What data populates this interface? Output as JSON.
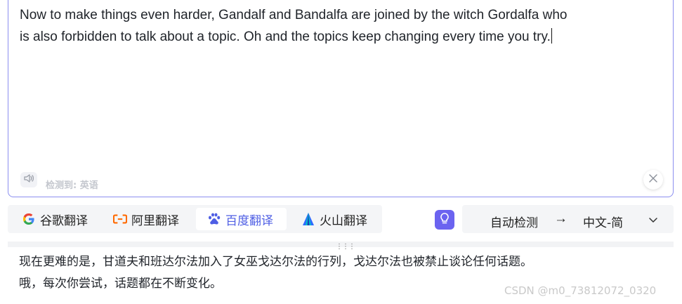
{
  "source": {
    "line1": "Now to make things even harder, Gandalf and Bandalfa are joined by the witch Gordalfa who",
    "line2": "is also forbidden to talk about a topic. Oh and the topics keep changing every time you try.",
    "detected_label": "检测到: 英语",
    "speaker_icon": "speaker-icon",
    "clear_icon": "close-icon"
  },
  "engines": [
    {
      "label": "谷歌翻译",
      "icon": "google-icon",
      "color": "#4285f4"
    },
    {
      "label": "阿里翻译",
      "icon": "alibaba-icon",
      "color": "#ff6a00"
    },
    {
      "label": "百度翻译",
      "icon": "baidu-icon",
      "color": "#4e5ee4",
      "active": true
    },
    {
      "label": "火山翻译",
      "icon": "volcano-icon",
      "color": "#3366ff"
    }
  ],
  "language": {
    "source": "自动检测",
    "arrow": "→",
    "target": "中文-简"
  },
  "result": {
    "line1": "现在更难的是，甘道夫和班达尔法加入了女巫戈达尔法的行列，戈达尔法也被禁止谈论任何话题。",
    "line2": "哦，每次你尝试，话题都在不断变化。"
  },
  "watermark": "CSDN @m0_73812072_0320",
  "colors": {
    "accent": "#6b63f0",
    "border": "#8b8ff0"
  }
}
